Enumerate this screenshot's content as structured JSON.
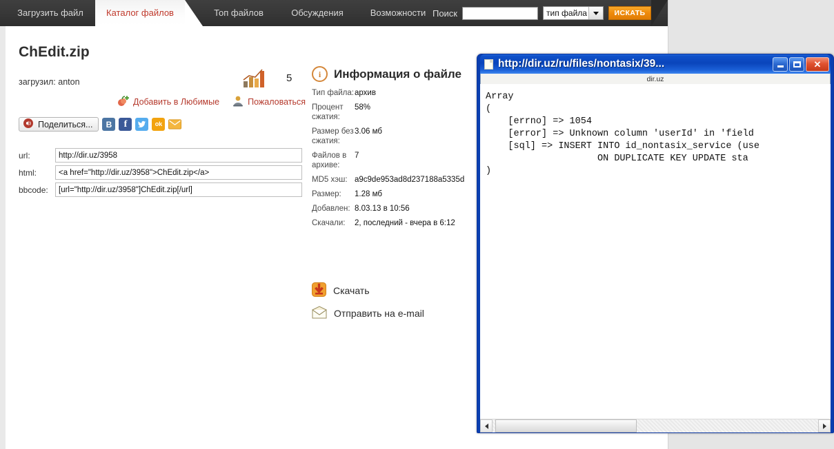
{
  "navbar": {
    "tabs": [
      {
        "label": "Загрузить файл",
        "active": false
      },
      {
        "label": "Каталог файлов",
        "active": true
      },
      {
        "label": "Топ файлов",
        "active": false
      },
      {
        "label": "Обсуждения",
        "active": false
      },
      {
        "label": "Возможности",
        "active": false
      }
    ],
    "search_label": "Поиск",
    "search_value": "",
    "search_placeholder": "",
    "filetype_selected": "тип файла",
    "search_button": "ИСКАТЬ",
    "accent_color": "#ef8a0b",
    "active_tab_color": "#c0392b",
    "bar_color": "#3b3b3b"
  },
  "file": {
    "title": "ChEdit.zip",
    "uploader_line": "загрузил: anton",
    "stats_count": "5",
    "favorite_label": "Добавить в Любимые",
    "complain_label": "Пожаловаться",
    "share_button": "Поделиться...",
    "share_networks": [
      {
        "name": "vk",
        "glyph": "B",
        "color": "#4c75a3"
      },
      {
        "name": "facebook",
        "glyph": "f",
        "color": "#3b5998"
      },
      {
        "name": "twitter",
        "glyph": "t",
        "color": "#55acee"
      },
      {
        "name": "odnoklassniki",
        "glyph": "ok",
        "color": "#f2a30f"
      },
      {
        "name": "email",
        "glyph": "envelope",
        "color": "#f0b323"
      }
    ],
    "embed": [
      {
        "label": "url:",
        "value": "http://dir.uz/3958"
      },
      {
        "label": "html:",
        "value": "<a href=\"http://dir.uz/3958\">ChEdit.zip</a>"
      },
      {
        "label": "bbcode:",
        "value": "[url=\"http://dir.uz/3958\"]ChEdit.zip[/url]"
      }
    ]
  },
  "info": {
    "heading": "Информация о файле",
    "rows": [
      {
        "key": "Тип файла:",
        "value": "архив"
      },
      {
        "key": "Процент сжатия:",
        "value": "58%"
      },
      {
        "key": "Размер без сжатия:",
        "value": "3.06 мб"
      },
      {
        "key": "Файлов в архиве:",
        "value": "7"
      },
      {
        "key": "MD5 хэш:",
        "value": "a9c9de953ad8d237188a5335d"
      },
      {
        "key": "Размер:",
        "value": "1.28 мб"
      },
      {
        "key": "Добавлен:",
        "value": "8.03.13 в 10:56"
      },
      {
        "key": "Скачали:",
        "value": "2, последний - вчера в 6:12"
      }
    ],
    "download_label": "Скачать",
    "email_label": "Отправить на e-mail"
  },
  "popup": {
    "title": "http://dir.uz/ru/files/nontasix/39...",
    "status_bar": "dir.uz",
    "minimize_title": "Свернуть",
    "maximize_title": "Развернуть",
    "close_title": "Закрыть",
    "content": "Array\n(\n    [errno] => 1054\n    [error] => Unknown column 'userId' in 'field \n    [sql] => INSERT INTO id_nontasix_service (use\n                    ON DUPLICATE KEY UPDATE sta\n)"
  }
}
